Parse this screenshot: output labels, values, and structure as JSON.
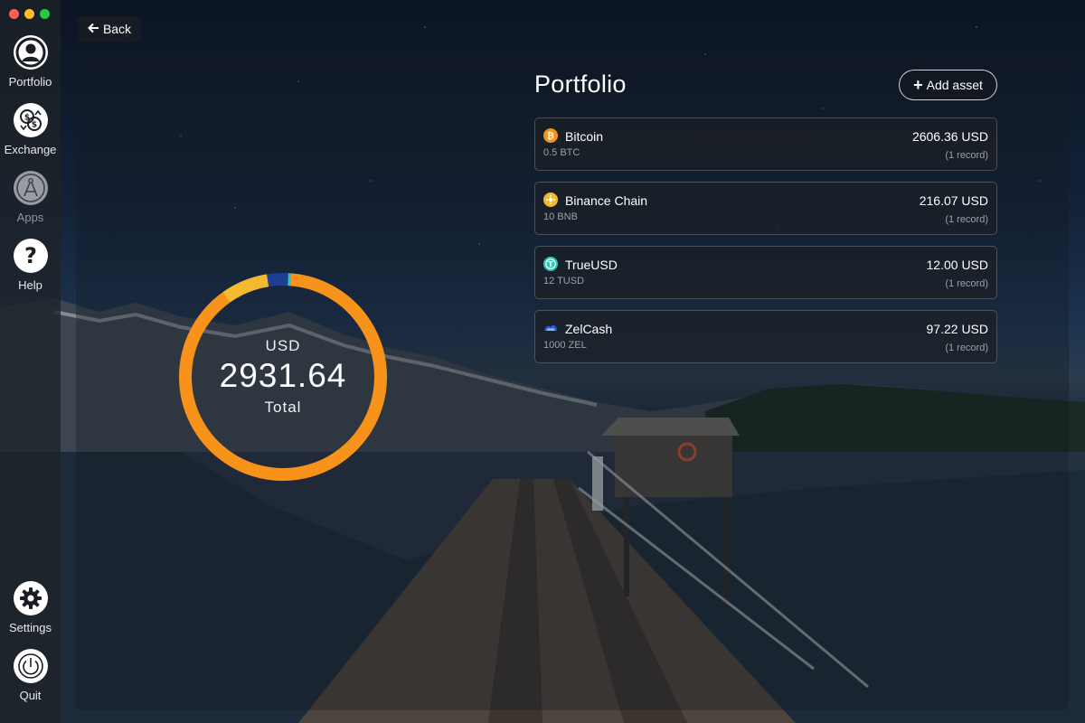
{
  "window": {
    "traffic_colors": [
      "#fe5f57",
      "#febc2e",
      "#28c840"
    ]
  },
  "sidebar": {
    "items": [
      {
        "label": "Portfolio",
        "icon": "user-icon"
      },
      {
        "label": "Exchange",
        "icon": "exchange-icon"
      },
      {
        "label": "Apps",
        "icon": "apps-compass-icon"
      },
      {
        "label": "Help",
        "icon": "help-icon"
      },
      {
        "label": "Settings",
        "icon": "gear-icon"
      },
      {
        "label": "Quit",
        "icon": "power-icon"
      }
    ]
  },
  "header": {
    "back_label": "Back",
    "title": "Portfolio",
    "add_label": "Add asset"
  },
  "summary": {
    "currency": "USD",
    "total": "2931.64",
    "total_label": "Total"
  },
  "chart_data": {
    "type": "pie",
    "categories": [
      "Bitcoin",
      "Binance Chain",
      "TrueUSD",
      "ZelCash"
    ],
    "values": [
      2606.36,
      216.07,
      12.0,
      97.22
    ],
    "colors": [
      "#f7931a",
      "#f3ba2f",
      "#2ec5b8",
      "#1f3d92"
    ]
  },
  "assets": [
    {
      "name": "Bitcoin",
      "amount": "0.5 BTC",
      "value": "2606.36 USD",
      "records": "(1 record)",
      "icon": "bitcoin-icon",
      "color": "#f7931a"
    },
    {
      "name": "Binance Chain",
      "amount": "10 BNB",
      "value": "216.07 USD",
      "records": "(1 record)",
      "icon": "binance-icon",
      "color": "#f3ba2f"
    },
    {
      "name": "TrueUSD",
      "amount": "12 TUSD",
      "value": "12.00 USD",
      "records": "(1 record)",
      "icon": "trueusd-icon",
      "color": "#2ec5b8"
    },
    {
      "name": "ZelCash",
      "amount": "1000 ZEL",
      "value": "97.22 USD",
      "records": "(1 record)",
      "icon": "zelcash-icon",
      "color": "#2a5bd7"
    }
  ]
}
